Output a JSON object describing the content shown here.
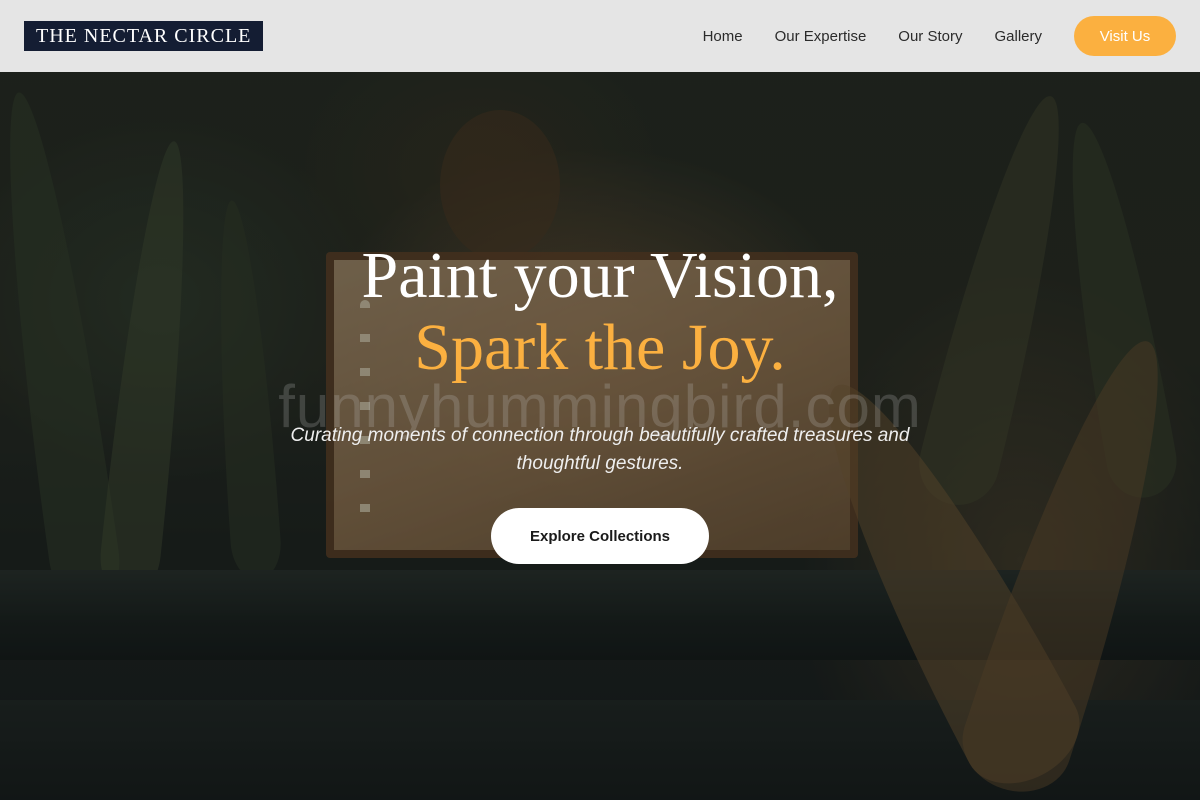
{
  "header": {
    "logo_text": "THE NECTAR CIRCLE",
    "nav": [
      {
        "label": "Home"
      },
      {
        "label": "Our Expertise"
      },
      {
        "label": "Our Story"
      },
      {
        "label": "Gallery"
      }
    ],
    "cta_label": "Visit Us"
  },
  "hero": {
    "headline_line1": "Paint your Vision,",
    "headline_line2": "Spark the Joy.",
    "subtitle": "Curating moments of connection through beautifully crafted treasures and thoughtful gestures.",
    "button_label": "Explore Collections",
    "watermark": "funnyhummingbird.com"
  },
  "colors": {
    "accent": "#fbb040",
    "logo_bg": "#141d33",
    "header_bg": "#f0f0f0"
  }
}
